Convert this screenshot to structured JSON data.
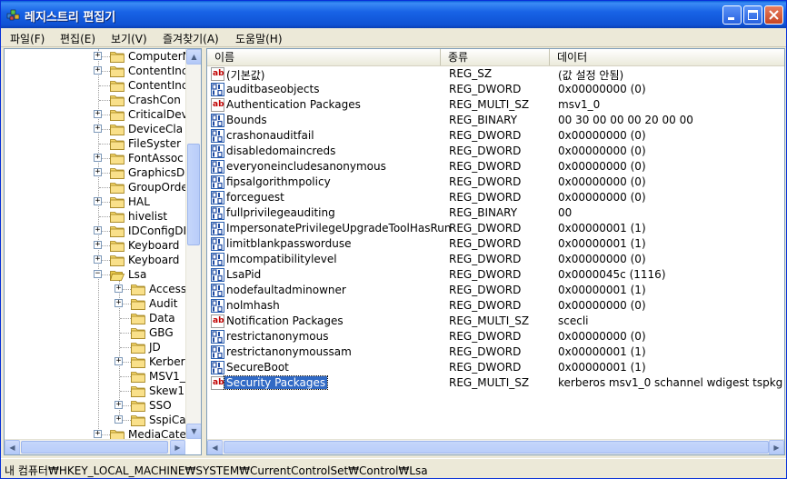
{
  "window": {
    "title": "레지스트리 편집기",
    "colors": {
      "titlebar": "#0a5fd8",
      "selection": "#316ac5"
    }
  },
  "menu": [
    "파일(F)",
    "편집(E)",
    "보기(V)",
    "즐겨찾기(A)",
    "도움말(H)"
  ],
  "tree": [
    {
      "label": "ComputerN",
      "expander": "+"
    },
    {
      "label": "ContentInc",
      "expander": "+"
    },
    {
      "label": "ContentInc",
      "expander": ""
    },
    {
      "label": "CrashCon",
      "expander": ""
    },
    {
      "label": "CriticalDev",
      "expander": "+"
    },
    {
      "label": "DeviceCla",
      "expander": "+"
    },
    {
      "label": "FileSyster",
      "expander": ""
    },
    {
      "label": "FontAssoc",
      "expander": "+"
    },
    {
      "label": "GraphicsD",
      "expander": "+"
    },
    {
      "label": "GroupOrde",
      "expander": ""
    },
    {
      "label": "HAL",
      "expander": "+"
    },
    {
      "label": "hivelist",
      "expander": ""
    },
    {
      "label": "IDConfigDI",
      "expander": "+"
    },
    {
      "label": "Keyboard",
      "expander": "+"
    },
    {
      "label": "Keyboard",
      "expander": "+"
    },
    {
      "label": "Lsa",
      "expander": "−",
      "open": true
    },
    {
      "label": "Access",
      "expander": "+",
      "child": true
    },
    {
      "label": "Audit",
      "expander": "+",
      "child": true
    },
    {
      "label": "Data",
      "expander": "",
      "child": true
    },
    {
      "label": "GBG",
      "expander": "",
      "child": true
    },
    {
      "label": "JD",
      "expander": "",
      "child": true
    },
    {
      "label": "Kerber",
      "expander": "+",
      "child": true
    },
    {
      "label": "MSV1_",
      "expander": "",
      "child": true
    },
    {
      "label": "Skew1",
      "expander": "",
      "child": true
    },
    {
      "label": "SSO",
      "expander": "+",
      "child": true
    },
    {
      "label": "SspiCa",
      "expander": "+",
      "child": true
    },
    {
      "label": "MediaCate",
      "expander": "+"
    }
  ],
  "list": {
    "columns": [
      "이름",
      "종류",
      "데이터"
    ],
    "rows": [
      {
        "name": "(기본값)",
        "type": "REG_SZ",
        "data": "(값 설정 안됨)",
        "icon": "string-value-icon"
      },
      {
        "name": "auditbaseobjects",
        "type": "REG_DWORD",
        "data": "0x00000000 (0)",
        "icon": "binary-value-icon"
      },
      {
        "name": "Authentication Packages",
        "type": "REG_MULTI_SZ",
        "data": "msv1_0",
        "icon": "string-value-icon"
      },
      {
        "name": "Bounds",
        "type": "REG_BINARY",
        "data": "00 30 00 00 00 20 00 00",
        "icon": "binary-value-icon"
      },
      {
        "name": "crashonauditfail",
        "type": "REG_DWORD",
        "data": "0x00000000 (0)",
        "icon": "binary-value-icon"
      },
      {
        "name": "disabledomaincreds",
        "type": "REG_DWORD",
        "data": "0x00000000 (0)",
        "icon": "binary-value-icon"
      },
      {
        "name": "everyoneincludesanonymous",
        "type": "REG_DWORD",
        "data": "0x00000000 (0)",
        "icon": "binary-value-icon"
      },
      {
        "name": "fipsalgorithmpolicy",
        "type": "REG_DWORD",
        "data": "0x00000000 (0)",
        "icon": "binary-value-icon"
      },
      {
        "name": "forceguest",
        "type": "REG_DWORD",
        "data": "0x00000000 (0)",
        "icon": "binary-value-icon"
      },
      {
        "name": "fullprivilegeauditing",
        "type": "REG_BINARY",
        "data": "00",
        "icon": "binary-value-icon"
      },
      {
        "name": "ImpersonatePrivilegeUpgradeToolHasRun",
        "type": "REG_DWORD",
        "data": "0x00000001 (1)",
        "icon": "binary-value-icon"
      },
      {
        "name": "limitblankpassworduse",
        "type": "REG_DWORD",
        "data": "0x00000001 (1)",
        "icon": "binary-value-icon"
      },
      {
        "name": "lmcompatibilitylevel",
        "type": "REG_DWORD",
        "data": "0x00000000 (0)",
        "icon": "binary-value-icon"
      },
      {
        "name": "LsaPid",
        "type": "REG_DWORD",
        "data": "0x0000045c (1116)",
        "icon": "binary-value-icon"
      },
      {
        "name": "nodefaultadminowner",
        "type": "REG_DWORD",
        "data": "0x00000001 (1)",
        "icon": "binary-value-icon"
      },
      {
        "name": "nolmhash",
        "type": "REG_DWORD",
        "data": "0x00000000 (0)",
        "icon": "binary-value-icon"
      },
      {
        "name": "Notification Packages",
        "type": "REG_MULTI_SZ",
        "data": "scecli",
        "icon": "string-value-icon"
      },
      {
        "name": "restrictanonymous",
        "type": "REG_DWORD",
        "data": "0x00000000 (0)",
        "icon": "binary-value-icon"
      },
      {
        "name": "restrictanonymoussam",
        "type": "REG_DWORD",
        "data": "0x00000001 (1)",
        "icon": "binary-value-icon"
      },
      {
        "name": "SecureBoot",
        "type": "REG_DWORD",
        "data": "0x00000001 (1)",
        "icon": "binary-value-icon"
      },
      {
        "name": "Security Packages",
        "type": "REG_MULTI_SZ",
        "data": "kerberos msv1_0 schannel wdigest tspkg",
        "icon": "string-value-icon",
        "selected": true
      }
    ]
  },
  "status": "내 컴퓨터₩HKEY_LOCAL_MACHINE₩SYSTEM₩CurrentControlSet₩Control₩Lsa"
}
